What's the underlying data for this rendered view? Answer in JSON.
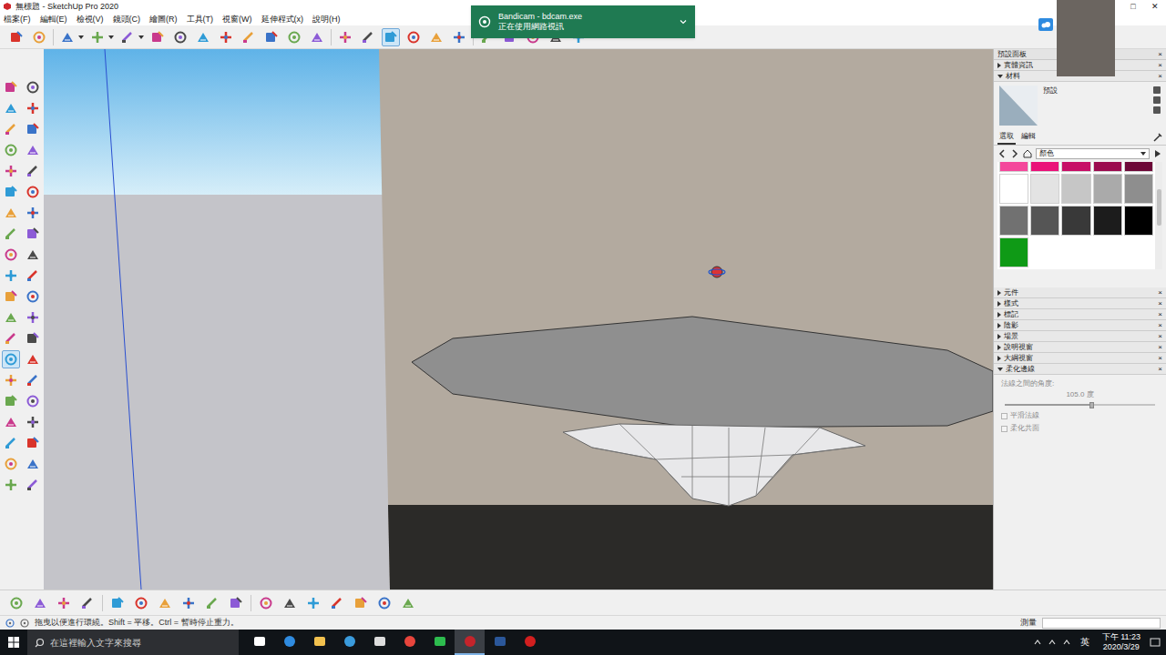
{
  "window": {
    "title": "無標題 - SketchUp Pro 2020",
    "controls": [
      "□",
      "✕"
    ]
  },
  "menu": [
    "檔案(F)",
    "編輯(E)",
    "檢視(V)",
    "鏡頭(C)",
    "繪圖(R)",
    "工具(T)",
    "視窗(W)",
    "延伸程式(x)",
    "說明(H)"
  ],
  "toolbar": {
    "items": [
      {
        "selected": false
      },
      {
        "selected": false
      },
      {
        "selected": false
      },
      {
        "selected": false
      },
      {
        "selected": false
      },
      {
        "selected": false
      },
      {
        "selected": false
      },
      {
        "selected": false
      },
      {
        "selected": false
      },
      {
        "selected": false
      },
      {
        "selected": false
      },
      {
        "selected": false
      },
      {
        "selected": false
      },
      {
        "selected": false
      },
      {
        "selected": false
      },
      {
        "selected": true
      },
      {
        "selected": false
      },
      {
        "selected": false
      },
      {
        "selected": false
      },
      {
        "selected": false
      },
      {
        "selected": false
      },
      {
        "selected": false
      },
      {
        "selected": false
      },
      {
        "selected": false
      }
    ]
  },
  "left_toolbar": {
    "items": [
      {
        "selected": false
      },
      {
        "selected": false
      },
      {
        "selected": false
      },
      {
        "selected": false
      },
      {
        "selected": false
      },
      {
        "selected": false
      },
      {
        "selected": false
      },
      {
        "selected": false
      },
      {
        "selected": false
      },
      {
        "selected": false
      },
      {
        "selected": false
      },
      {
        "selected": false
      },
      {
        "selected": false
      },
      {
        "selected": false
      },
      {
        "selected": false
      },
      {
        "selected": false
      },
      {
        "selected": false
      },
      {
        "selected": false
      },
      {
        "selected": false
      },
      {
        "selected": false
      },
      {
        "selected": false
      },
      {
        "selected": false
      },
      {
        "selected": false
      },
      {
        "selected": false
      },
      {
        "selected": false
      },
      {
        "selected": false
      },
      {
        "selected": true
      },
      {
        "selected": false
      },
      {
        "selected": false
      },
      {
        "selected": false
      },
      {
        "selected": false
      },
      {
        "selected": false
      },
      {
        "selected": false
      },
      {
        "selected": false
      },
      {
        "selected": false
      },
      {
        "selected": false
      },
      {
        "selected": false
      },
      {
        "selected": false
      },
      {
        "selected": false
      },
      {
        "selected": false
      }
    ]
  },
  "bottom_toolbar": {
    "items": [
      {
        "selected": false
      },
      {
        "selected": false
      },
      {
        "selected": false
      },
      {
        "selected": false
      },
      {
        "selected": false
      },
      {
        "selected": false
      },
      {
        "selected": false
      },
      {
        "selected": false
      },
      {
        "selected": false
      },
      {
        "selected": false
      },
      {
        "selected": false
      },
      {
        "selected": false
      },
      {
        "selected": false
      },
      {
        "selected": false
      },
      {
        "selected": false
      },
      {
        "selected": false
      },
      {
        "selected": false
      }
    ]
  },
  "notification": {
    "title": "Bandicam - bdcam.exe",
    "message": "正在使用網路視訊"
  },
  "tray": {
    "title": "預設面板",
    "close": "×",
    "sections": [
      {
        "label": "實體資訊",
        "expanded": false
      },
      {
        "label": "材料",
        "expanded": true
      },
      {
        "label": "元件",
        "expanded": false
      },
      {
        "label": "樣式",
        "expanded": false
      },
      {
        "label": "標記",
        "expanded": false
      },
      {
        "label": "陰影",
        "expanded": false
      },
      {
        "label": "場景",
        "expanded": false
      },
      {
        "label": "說明視窗",
        "expanded": false
      },
      {
        "label": "大綱視窗",
        "expanded": false
      },
      {
        "label": "柔化邊線",
        "expanded": true
      }
    ]
  },
  "materials": {
    "name": "預設",
    "tabs": [
      {
        "label": "選取",
        "selected": true
      },
      {
        "label": "編輯",
        "selected": false
      }
    ],
    "collection": "顏色",
    "swatches": [
      {
        "color": "#f4479b"
      },
      {
        "color": "#ea1279"
      },
      {
        "color": "#c70e66"
      },
      {
        "color": "#9b0b4f"
      },
      {
        "color": "#6d0838"
      },
      {
        "color": "#ffffff"
      },
      {
        "color": "#e3e3e3"
      },
      {
        "color": "#c6c6c6"
      },
      {
        "color": "#aaaaaa"
      },
      {
        "color": "#8e8e8e"
      },
      {
        "color": "#717171"
      },
      {
        "color": "#555555"
      },
      {
        "color": "#393939"
      },
      {
        "color": "#1c1c1c"
      },
      {
        "color": "#000000"
      },
      {
        "color": "#0f9a16"
      }
    ]
  },
  "soften": {
    "label": "法線之間的角度:",
    "value": "105.0 度",
    "level": 0.58,
    "options": [
      {
        "label": "平滑法線",
        "checked": false,
        "disabled": true
      },
      {
        "label": "柔化共面",
        "checked": false,
        "disabled": true
      }
    ]
  },
  "status_bar": {
    "hint": "拖曳以便進行環繞。Shift = 平移。Ctrl = 暫時停止重力。",
    "measure_label": "測量",
    "measure_value": ""
  },
  "taskbar": {
    "search": {
      "placeholder": "在這裡輸入文字來搜尋"
    },
    "apps": [
      {
        "active": false
      },
      {
        "active": false
      },
      {
        "active": false
      },
      {
        "active": false
      },
      {
        "active": false
      },
      {
        "active": false
      },
      {
        "active": false
      },
      {
        "active": true
      },
      {
        "active": false
      },
      {
        "active": false
      }
    ],
    "ime": "英",
    "time": "下午 11:23",
    "date": "2020/3/29"
  }
}
